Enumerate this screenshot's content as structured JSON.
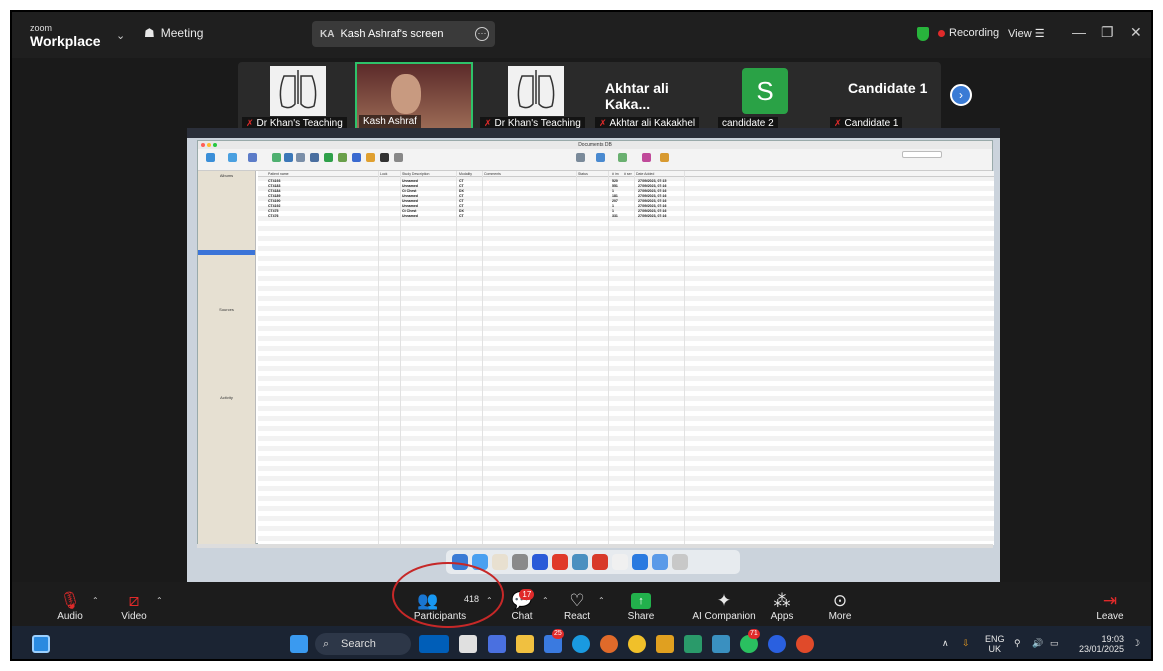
{
  "titlebar": {
    "logo_small": "zoom",
    "logo_big": "Workplace",
    "meeting_label": "Meeting",
    "share_initials": "KA",
    "share_label": "Kash Ashraf's screen",
    "recording_label": "Recording",
    "view_label": "View"
  },
  "participants_strip": {
    "tiles": [
      {
        "name": "Dr Khan's Teaching"
      },
      {
        "name": "Kash Ashraf"
      },
      {
        "name": "Dr Khan's Teaching"
      },
      {
        "name": "Akhtar ali Kakakhel",
        "big_name": "Akhtar ali Kaka..."
      },
      {
        "name": "candidate 2",
        "avatar_letter": "S"
      },
      {
        "name": "Candidate 1",
        "big_name": "Candidate 1"
      }
    ]
  },
  "shared_screen": {
    "window_title": "Documents DB",
    "sidebar_title": "Albums",
    "sidebar_sources": "Sources",
    "sidebar_activity": "Activity",
    "table_headers": [
      "Patient name",
      "Lock",
      "Study Description",
      "Modality",
      "Comments",
      "Status",
      "# im",
      "# ser",
      "Date Added"
    ],
    "rows": [
      [
        "CT4193",
        "Unnamed",
        "CT",
        "520",
        "27/09/2023, 07:15"
      ],
      [
        "CT4183",
        "Unnamed",
        "CT",
        "551",
        "27/09/2023, 07:16"
      ],
      [
        "CT4184",
        "Ct Chest",
        "DX",
        "1",
        "27/09/2023, 07:16"
      ],
      [
        "CT4189",
        "Unnamed",
        "CT",
        "181",
        "27/09/2023, 07:16"
      ],
      [
        "CT4190",
        "Unnamed",
        "CT",
        "207",
        "27/09/2023, 07:16"
      ],
      [
        "CT4192",
        "Unnamed",
        "CT",
        "1",
        "27/09/2023, 07:16"
      ],
      [
        "CT475",
        "Ct Chest",
        "DX",
        "1",
        "27/09/2023, 07:16"
      ],
      [
        "CT476",
        "Unnamed",
        "CT",
        "331",
        "27/09/2023, 07:16"
      ]
    ]
  },
  "controls": {
    "audio": "Audio",
    "video": "Video",
    "participants": "Participants",
    "participants_count": "418",
    "chat": "Chat",
    "chat_badge": "17",
    "react": "React",
    "share": "Share",
    "ai_companion": "AI Companion",
    "apps": "Apps",
    "more": "More",
    "leave": "Leave"
  },
  "taskbar": {
    "search_placeholder": "Search",
    "badge_a": "25",
    "badge_b": "71",
    "lang": "ENG",
    "region": "UK",
    "time": "19:03",
    "date": "23/01/2025"
  },
  "colors": {
    "zoom_green": "#22b14c",
    "recording_red": "#e02a2a",
    "highlight_circle": "#c62828"
  }
}
